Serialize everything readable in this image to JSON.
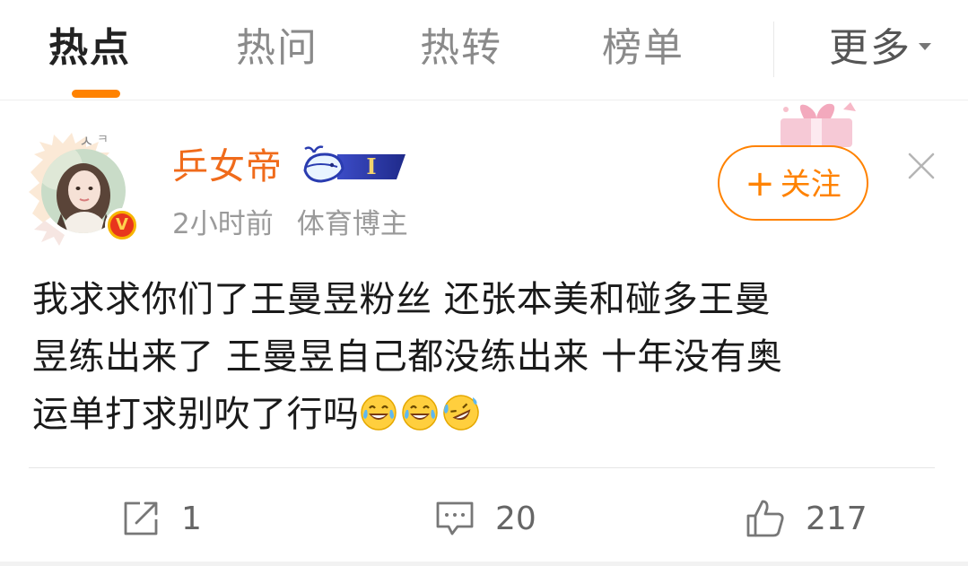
{
  "tabs": [
    {
      "label": "热点",
      "active": true
    },
    {
      "label": "热问",
      "active": false
    },
    {
      "label": "热转",
      "active": false
    },
    {
      "label": "榜单",
      "active": false
    }
  ],
  "more_label": "更多",
  "post": {
    "username": "乒女帝",
    "member_badge_text": "I",
    "verified_badge": "V",
    "time": "2小时前",
    "source": "体育博主",
    "follow_label": "关注",
    "text_line1": "我求求你们了王曼昱粉丝  还张本美和碰多王曼",
    "text_line2": "昱练出来了 王曼昱自己都没练出来 十年没有奥",
    "text_line3": "运单打求别吹了行吗",
    "emojis": [
      "laugh-cry-icon",
      "laugh-cry-icon",
      "rofl-icon"
    ]
  },
  "actions": {
    "repost_count": "1",
    "comment_count": "20",
    "like_count": "217"
  },
  "colors": {
    "accent": "#ff8200",
    "username": "#f06b1b"
  }
}
